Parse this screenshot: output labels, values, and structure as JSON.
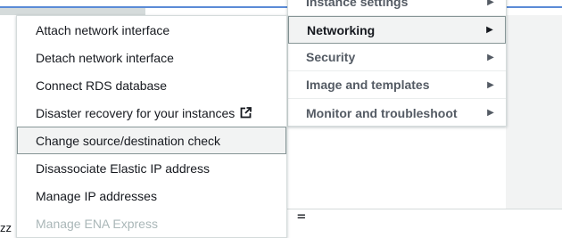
{
  "background": {
    "divider_glyph": "=",
    "truncated_text": "zz"
  },
  "main_menu": {
    "items": [
      {
        "label": "Instance settings",
        "icon": "caret-right-icon"
      },
      {
        "label": "Networking",
        "icon": "caret-right-icon"
      },
      {
        "label": "Security",
        "icon": "caret-right-icon"
      },
      {
        "label": "Image and templates",
        "icon": "caret-right-icon"
      },
      {
        "label": "Monitor and troubleshoot",
        "icon": "caret-right-icon"
      }
    ],
    "active_item": "Networking",
    "caret_glyph": "▶"
  },
  "networking_submenu": {
    "items": [
      {
        "label": "Attach network interface"
      },
      {
        "label": "Detach network interface"
      },
      {
        "label": "Connect RDS database"
      },
      {
        "label": "Disaster recovery for your instances",
        "icon": "external-link-icon"
      },
      {
        "label": "Change source/destination check"
      },
      {
        "label": "Disassociate Elastic IP address"
      },
      {
        "label": "Manage IP addresses"
      },
      {
        "label": "Manage ENA Express"
      }
    ],
    "highlighted_item": "Change source/destination check",
    "disabled_item": "Manage ENA Express"
  },
  "colors": {
    "accent_line": "#5b8bd6",
    "text": "#16191f",
    "muted_text": "#545b64",
    "disabled_text": "#aab7b8",
    "hover_bg": "#f2f3f3",
    "border": "#d5dbdb"
  }
}
